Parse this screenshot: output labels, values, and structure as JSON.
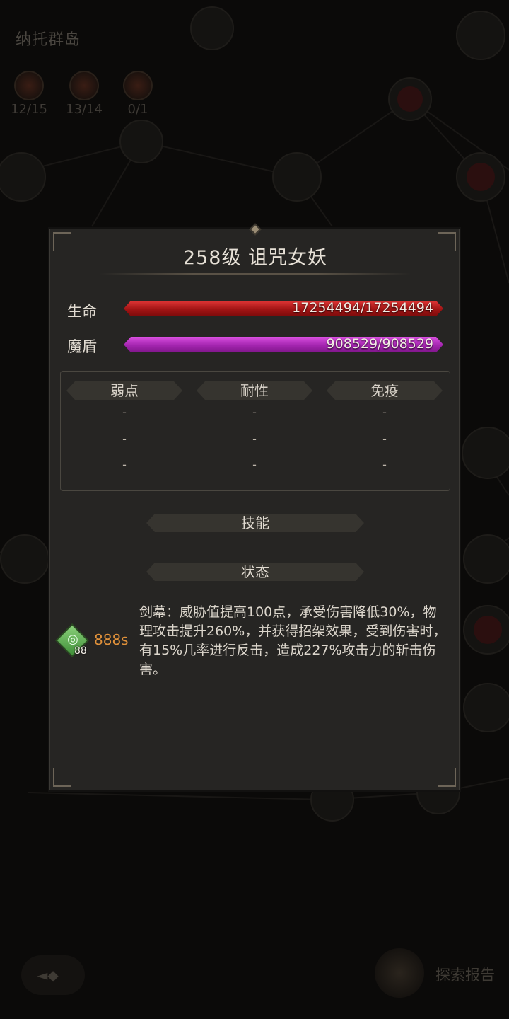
{
  "background": {
    "region_title": "纳托群岛",
    "counters": [
      {
        "label": "12/15"
      },
      {
        "label": "13/14"
      },
      {
        "label": "0/1"
      }
    ],
    "explore_label": "探索报告"
  },
  "panel": {
    "title": "258级  诅咒女妖",
    "hp": {
      "label": "生命",
      "value_text": "17254494/17254494",
      "fraction": 1.0,
      "color": "#c21a1a"
    },
    "mana_shield": {
      "label": "魔盾",
      "value_text": "908529/908529",
      "fraction": 1.0,
      "color": "#b22dbf"
    },
    "resistances": {
      "headers": [
        "弱点",
        "耐性",
        "免疫"
      ],
      "rows": [
        [
          "-",
          "-",
          "-"
        ],
        [
          "-",
          "-",
          "-"
        ],
        [
          "-",
          "-",
          "-"
        ]
      ]
    },
    "skills_header": "技能",
    "status_header": "状态",
    "effect": {
      "icon": "swirl-buff-icon",
      "stack": "88",
      "time": "888s",
      "description": "剑幕：威胁值提高100点，承受伤害降低30%，物理攻击提升260%，并获得招架效果，受到伤害时，有15%几率进行反击，造成227%攻击力的斩击伤害。"
    }
  }
}
